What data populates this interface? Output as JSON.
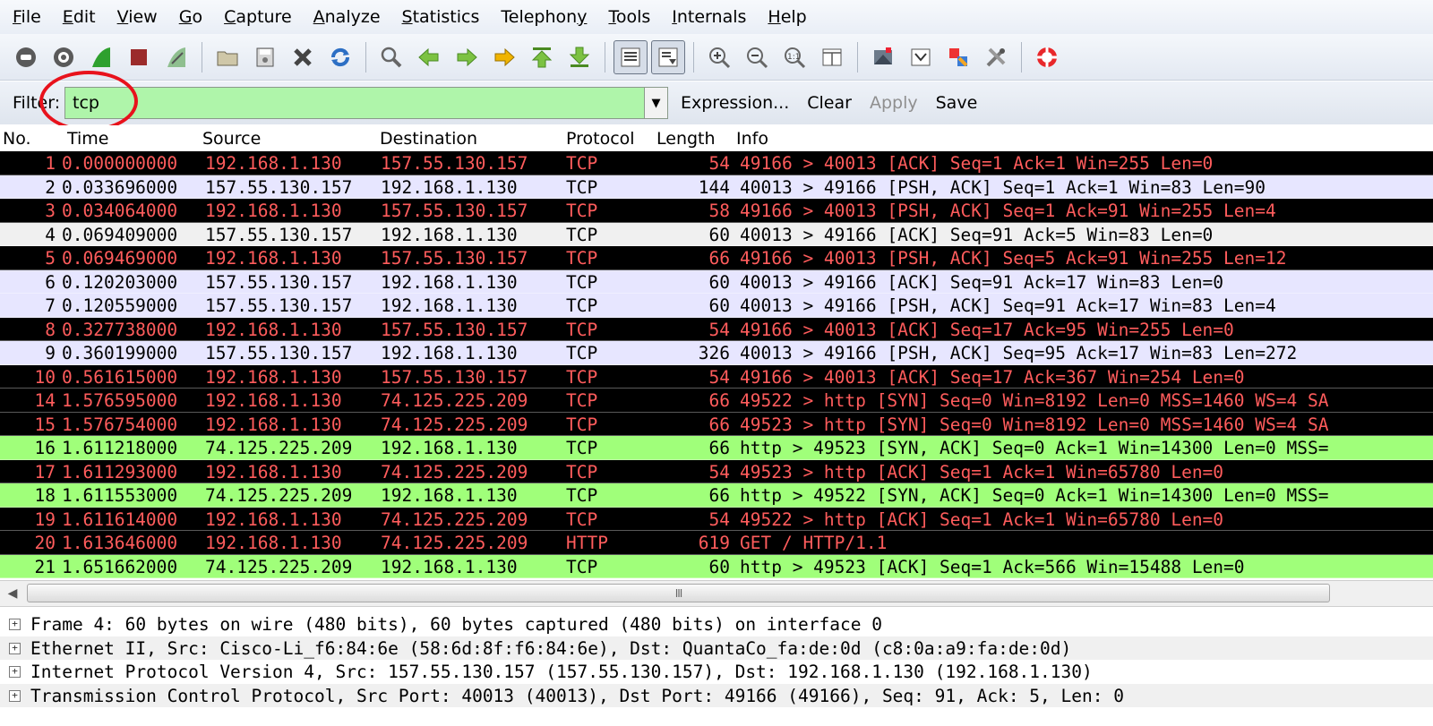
{
  "menu": [
    {
      "u": "F",
      "rest": "ile"
    },
    {
      "u": "E",
      "rest": "dit"
    },
    {
      "u": "V",
      "rest": "iew"
    },
    {
      "u": "G",
      "rest": "o"
    },
    {
      "u": "C",
      "rest": "apture"
    },
    {
      "u": "A",
      "rest": "nalyze"
    },
    {
      "u": "S",
      "rest": "tatistics"
    },
    {
      "u": "",
      "rest": "Telephon",
      "u2": "y"
    },
    {
      "u": "T",
      "rest": "ools"
    },
    {
      "u": "",
      "pre": "I",
      "rest": "nternals",
      "u3": "I"
    },
    {
      "u": "H",
      "rest": "elp"
    }
  ],
  "filter": {
    "label": "Filter:",
    "value": "tcp",
    "buttons": [
      "Expression...",
      "Clear",
      "Apply",
      "Save"
    ]
  },
  "columns": {
    "no": "No.",
    "time": "Time",
    "source": "Source",
    "destination": "Destination",
    "protocol": "Protocol",
    "length": "Length",
    "info": "Info"
  },
  "colors": {
    "dark_bg": "#000000",
    "dark_fg": "#ff5c5c",
    "lavender_bg": "#e7e6ff",
    "gray_bg": "#f0f0f0",
    "green_bg": "#a0ff7a",
    "normal_fg": "#000000"
  },
  "packets": [
    {
      "no": "1",
      "time": "0.000000000",
      "src": "192.168.1.130",
      "dst": "157.55.130.157",
      "proto": "TCP",
      "len": "54",
      "info": "49166 > 40013 [ACK] Seq=1 Ack=1 Win=255 Len=0",
      "style": "dark"
    },
    {
      "no": "2",
      "time": "0.033696000",
      "src": "157.55.130.157",
      "dst": "192.168.1.130",
      "proto": "TCP",
      "len": "144",
      "info": "40013 > 49166 [PSH, ACK] Seq=1 Ack=1 Win=83 Len=90",
      "style": "lavender"
    },
    {
      "no": "3",
      "time": "0.034064000",
      "src": "192.168.1.130",
      "dst": "157.55.130.157",
      "proto": "TCP",
      "len": "58",
      "info": "49166 > 40013 [PSH, ACK] Seq=1 Ack=91 Win=255 Len=4",
      "style": "dark"
    },
    {
      "no": "4",
      "time": "0.069409000",
      "src": "157.55.130.157",
      "dst": "192.168.1.130",
      "proto": "TCP",
      "len": "60",
      "info": "40013 > 49166 [ACK] Seq=91 Ack=5 Win=83 Len=0",
      "style": "gray"
    },
    {
      "no": "5",
      "time": "0.069469000",
      "src": "192.168.1.130",
      "dst": "157.55.130.157",
      "proto": "TCP",
      "len": "66",
      "info": "49166 > 40013 [PSH, ACK] Seq=5 Ack=91 Win=255 Len=12",
      "style": "dark"
    },
    {
      "no": "6",
      "time": "0.120203000",
      "src": "157.55.130.157",
      "dst": "192.168.1.130",
      "proto": "TCP",
      "len": "60",
      "info": "40013 > 49166 [ACK] Seq=91 Ack=17 Win=83 Len=0",
      "style": "lavender"
    },
    {
      "no": "7",
      "time": "0.120559000",
      "src": "157.55.130.157",
      "dst": "192.168.1.130",
      "proto": "TCP",
      "len": "60",
      "info": "40013 > 49166 [PSH, ACK] Seq=91 Ack=17 Win=83 Len=4",
      "style": "lavender"
    },
    {
      "no": "8",
      "time": "0.327738000",
      "src": "192.168.1.130",
      "dst": "157.55.130.157",
      "proto": "TCP",
      "len": "54",
      "info": "49166 > 40013 [ACK] Seq=17 Ack=95 Win=255 Len=0",
      "style": "dark"
    },
    {
      "no": "9",
      "time": "0.360199000",
      "src": "157.55.130.157",
      "dst": "192.168.1.130",
      "proto": "TCP",
      "len": "326",
      "info": "40013 > 49166 [PSH, ACK] Seq=95 Ack=17 Win=83 Len=272",
      "style": "lavender"
    },
    {
      "no": "10",
      "time": "0.561615000",
      "src": "192.168.1.130",
      "dst": "157.55.130.157",
      "proto": "TCP",
      "len": "54",
      "info": "49166 > 40013 [ACK] Seq=17 Ack=367 Win=254 Len=0",
      "style": "dark"
    },
    {
      "no": "14",
      "time": "1.576595000",
      "src": "192.168.1.130",
      "dst": "74.125.225.209",
      "proto": "TCP",
      "len": "66",
      "info": "49522 > http [SYN] Seq=0 Win=8192 Len=0 MSS=1460 WS=4 SA",
      "style": "dark"
    },
    {
      "no": "15",
      "time": "1.576754000",
      "src": "192.168.1.130",
      "dst": "74.125.225.209",
      "proto": "TCP",
      "len": "66",
      "info": "49523 > http [SYN] Seq=0 Win=8192 Len=0 MSS=1460 WS=4 SA",
      "style": "dark"
    },
    {
      "no": "16",
      "time": "1.611218000",
      "src": "74.125.225.209",
      "dst": "192.168.1.130",
      "proto": "TCP",
      "len": "66",
      "info": "http > 49523 [SYN, ACK] Seq=0 Ack=1 Win=14300 Len=0 MSS=",
      "style": "green"
    },
    {
      "no": "17",
      "time": "1.611293000",
      "src": "192.168.1.130",
      "dst": "74.125.225.209",
      "proto": "TCP",
      "len": "54",
      "info": "49523 > http [ACK] Seq=1 Ack=1 Win=65780 Len=0",
      "style": "dark"
    },
    {
      "no": "18",
      "time": "1.611553000",
      "src": "74.125.225.209",
      "dst": "192.168.1.130",
      "proto": "TCP",
      "len": "66",
      "info": "http > 49522 [SYN, ACK] Seq=0 Ack=1 Win=14300 Len=0 MSS=",
      "style": "green"
    },
    {
      "no": "19",
      "time": "1.611614000",
      "src": "192.168.1.130",
      "dst": "74.125.225.209",
      "proto": "TCP",
      "len": "54",
      "info": "49522 > http [ACK] Seq=1 Ack=1 Win=65780 Len=0",
      "style": "dark"
    },
    {
      "no": "20",
      "time": "1.613646000",
      "src": "192.168.1.130",
      "dst": "74.125.225.209",
      "proto": "HTTP",
      "len": "619",
      "info": "GET / HTTP/1.1",
      "style": "dark"
    },
    {
      "no": "21",
      "time": "1.651662000",
      "src": "74.125.225.209",
      "dst": "192.168.1.130",
      "proto": "TCP",
      "len": "60",
      "info": "http > 49523 [ACK] Seq=1 Ack=566 Win=15488 Len=0",
      "style": "green"
    }
  ],
  "scrollbar": {
    "thumb_grip": "III"
  },
  "details": [
    {
      "expander": "+",
      "text": "Frame 4: 60 bytes on wire (480 bits), 60 bytes captured (480 bits) on interface 0"
    },
    {
      "expander": "+",
      "text": "Ethernet II, Src: Cisco-Li_f6:84:6e (58:6d:8f:f6:84:6e), Dst: QuantaCo_fa:de:0d (c8:0a:a9:fa:de:0d)"
    },
    {
      "expander": "+",
      "text": "Internet Protocol Version 4, Src: 157.55.130.157 (157.55.130.157), Dst: 192.168.1.130 (192.168.1.130)"
    },
    {
      "expander": "+",
      "text": "Transmission Control Protocol, Src Port: 40013 (40013), Dst Port: 49166 (49166), Seq: 91, Ack: 5, Len: 0"
    }
  ],
  "toolbar_icons": [
    "interface-list-icon",
    "capture-options-icon",
    "start-capture-icon",
    "stop-capture-icon",
    "restart-capture-icon",
    "open-file-icon",
    "save-file-icon",
    "close-file-icon",
    "reload-icon",
    "find-packet-icon",
    "go-back-icon",
    "go-forward-icon",
    "go-to-packet-icon",
    "first-packet-icon",
    "last-packet-icon",
    "colorize-icon",
    "autoscroll-icon",
    "zoom-in-icon",
    "zoom-out-icon",
    "normal-size-icon",
    "resize-columns-icon",
    "capture-filters-icon",
    "display-filters-icon",
    "coloring-rules-icon",
    "preferences-icon",
    "help-icon"
  ]
}
